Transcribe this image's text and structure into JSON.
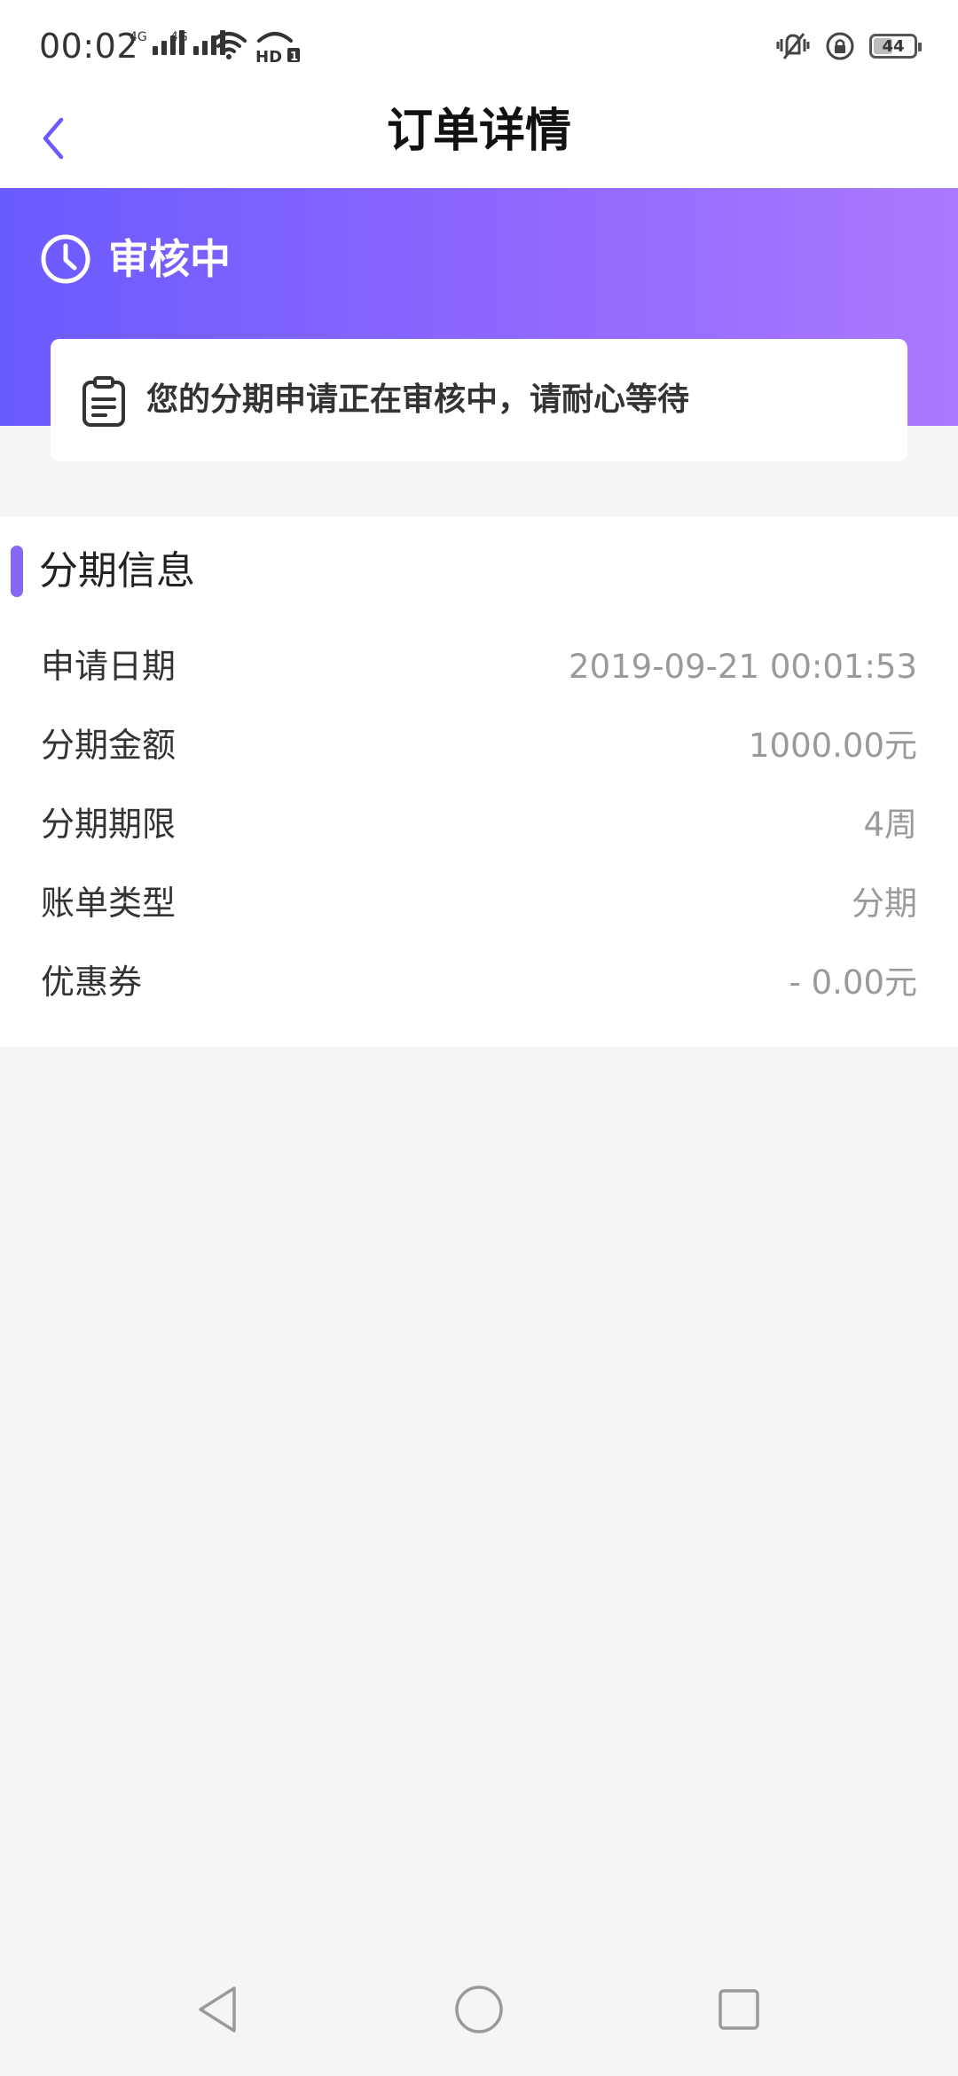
{
  "status_bar": {
    "time": "00:02",
    "signal_1_label": "4G",
    "signal_2_label": "4G",
    "hd_label": "HD",
    "hd_sub": "1",
    "battery_level": "44",
    "battery_fraction": 0.44,
    "icons": [
      "signal-icon",
      "signal-icon",
      "wifi-icon",
      "hd-icon",
      "vibrate-icon",
      "rotation-lock-icon",
      "battery-icon"
    ]
  },
  "header": {
    "title": "订单详情",
    "back_icon": "chevron-left-icon"
  },
  "status_banner": {
    "label": "审核中",
    "icon": "clock-icon",
    "notice": "您的分期申请正在审核中，请耐心等待",
    "notice_icon": "clipboard-icon",
    "gradient_start": "#6a5bff",
    "gradient_end": "#ab79fd"
  },
  "info_section": {
    "title": "分期信息",
    "accent_color": "#8567f4",
    "rows": [
      {
        "label": "申请日期",
        "value": "2019-09-21 00:01:53"
      },
      {
        "label": "分期金额",
        "value": "1000.00元"
      },
      {
        "label": "分期期限",
        "value": "4周"
      },
      {
        "label": "账单类型",
        "value": "分期"
      },
      {
        "label": "优惠券",
        "value": "- 0.00元"
      }
    ]
  },
  "nav_bar": {
    "icons": [
      "nav-back-icon",
      "nav-home-icon",
      "nav-recent-icon"
    ]
  }
}
